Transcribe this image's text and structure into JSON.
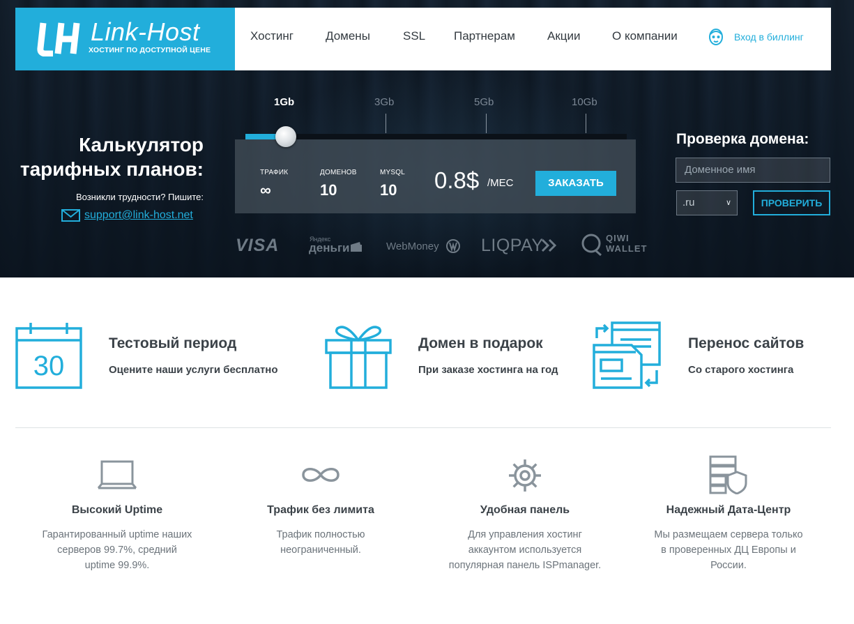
{
  "brand": {
    "logo_mark": "LH",
    "name": "Link-Host",
    "tagline": "ХОСТИНГ ПО ДОСТУПНОЙ ЦЕНЕ",
    "accent_color": "#22aedb"
  },
  "nav": {
    "items": [
      {
        "label": "Хостинг"
      },
      {
        "label": "Домены"
      },
      {
        "label": "SSL"
      },
      {
        "label": "Партнерам"
      },
      {
        "label": "Акции"
      },
      {
        "label": "О компании"
      }
    ],
    "login_label": "Вход в биллинг",
    "login_icon": "user-face-icon"
  },
  "calculator": {
    "title_line1": "Калькулятор",
    "title_line2": "тарифных планов:",
    "hint": "Возникли трудности? Пишите:",
    "email": "support@link-host.net",
    "slider": {
      "ticks": [
        "1Gb",
        "3Gb",
        "5Gb",
        "10Gb"
      ],
      "selected": "1Gb",
      "fill_fraction": 0.1
    },
    "stats": [
      {
        "label": "ТРАФИК",
        "value": "∞"
      },
      {
        "label": "ДОМЕНОВ",
        "value": "10"
      },
      {
        "label": "MYSQL",
        "value": "10"
      }
    ],
    "price": "0.8$",
    "period": "/МЕС",
    "order_label": "ЗАКАЗАТЬ"
  },
  "payments": [
    "VISA",
    "Яндекс",
    "деньги",
    "WebMoney",
    "LIQPAY",
    "QIWI",
    "WALLET"
  ],
  "domain_check": {
    "title": "Проверка домена:",
    "placeholder": "Доменное имя",
    "zone": ".ru",
    "button_label": "ПРОВЕРИТЬ"
  },
  "features_top": [
    {
      "icon": "calendar-icon",
      "icon_text": "30",
      "title": "Тестовый период",
      "subtitle": "Оцените наши услуги бесплатно"
    },
    {
      "icon": "gift-icon",
      "title": "Домен в подарок",
      "subtitle": "При заказе хостинга на год"
    },
    {
      "icon": "transfer-icon",
      "title": "Перенос сайтов",
      "subtitle": "Со старого хостинга"
    }
  ],
  "features_bottom": [
    {
      "icon": "laptop-icon",
      "title": "Высокий Uptime",
      "text_lines": [
        "Гарантированный uptime наших",
        "серверов 99.7%, средний",
        "uptime 99.9%."
      ]
    },
    {
      "icon": "infinity-icon",
      "title": "Трафик без лимита",
      "text_lines": [
        "Трафик полностью",
        "неограниченный."
      ]
    },
    {
      "icon": "gear-icon",
      "title": "Удобная панель",
      "text_lines": [
        "Для управления хостинг",
        "аккаунтом используется",
        "популярная панель ISPmanager."
      ]
    },
    {
      "icon": "server-shield-icon",
      "title": "Надежный Дата-Центр",
      "text_lines": [
        "Мы размещаем сервера только",
        "в проверенных ДЦ Европы и",
        "России."
      ]
    }
  ]
}
